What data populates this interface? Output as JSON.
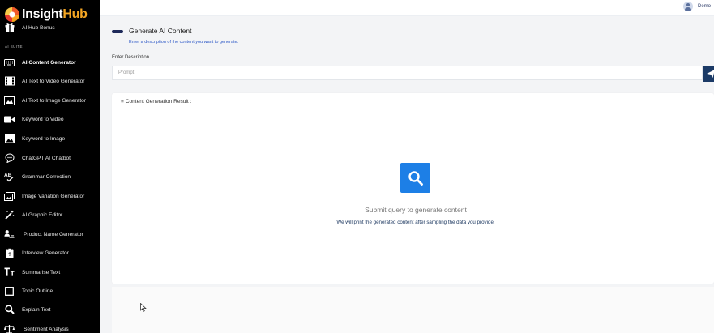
{
  "brand": {
    "name_a": "Insight",
    "name_b": "Hub"
  },
  "sidebar": {
    "bonus": "AI Hub Bonus",
    "section": "AI SUITE",
    "items": [
      {
        "label": "AI Content Generator",
        "icon": "keyboard-icon",
        "active": true
      },
      {
        "label": "AI Text to Video Generator",
        "icon": "film-icon"
      },
      {
        "label": "AI Text to Image Generator",
        "icon": "image-icon"
      },
      {
        "label": "Keyword to Video",
        "icon": "video-camera-icon"
      },
      {
        "label": "Keyword to Image",
        "icon": "photo-icon"
      },
      {
        "label": "ChatGPT AI Chatbot",
        "icon": "chat-bubble-icon"
      },
      {
        "label": "Grammar Correction",
        "icon": "spellcheck-icon"
      },
      {
        "label": "Image Variation Generator",
        "icon": "image-stack-icon"
      },
      {
        "label": "AI Graphic Editor",
        "icon": "magic-wand-icon"
      },
      {
        "label": "Product Name Generator",
        "icon": "product-icon"
      },
      {
        "label": "Interview Generator",
        "icon": "clipboard-icon"
      },
      {
        "label": "Summarise Text",
        "icon": "text-size-icon"
      },
      {
        "label": "Topic Outline",
        "icon": "outline-square-icon"
      },
      {
        "label": "Explain Text",
        "icon": "magnifier-icon"
      },
      {
        "label": "Sentiment Analysis",
        "icon": "scales-icon"
      }
    ]
  },
  "topbar": {
    "user": "Demo"
  },
  "main": {
    "title": "Generate AI Content",
    "subtitle": "Enter a description of the content you want to generate.",
    "description_label": "Enter Description",
    "prompt_placeholder": "Prompt",
    "result_title": "Content Generation Result :",
    "empty_title": "Submit query to generate content",
    "empty_text": "We will print the generated content after sampling the data you provide."
  },
  "colors": {
    "sidebar_bg": "#000000",
    "accent_blue": "#1d7fe6",
    "send_button": "#1b3a66",
    "brand_orange": "#f5a623"
  }
}
